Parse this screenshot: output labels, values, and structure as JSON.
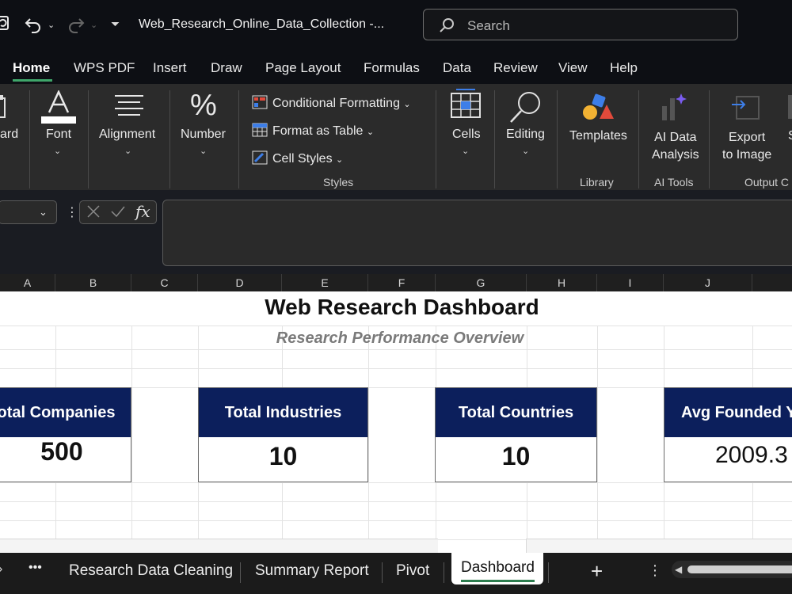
{
  "titlebar": {
    "document_title": "Web_Research_Online_Data_Collection  -...",
    "search_placeholder": "Search"
  },
  "ribbon_tabs": [
    "Home",
    "WPS PDF",
    "Insert",
    "Draw",
    "Page Layout",
    "Formulas",
    "Data",
    "Review",
    "View",
    "Help"
  ],
  "ribbon": {
    "clipboard_label": "ard",
    "font_label": "Font",
    "alignment_label": "Alignment",
    "number_label": "Number",
    "conditional_formatting": "Conditional Formatting",
    "format_as_table": "Format as Table",
    "cell_styles": "Cell Styles",
    "styles_group": "Styles",
    "cells_label": "Cells",
    "editing_label": "Editing",
    "templates_label": "Templates",
    "library_group": "Library",
    "ai_data_line1": "AI Data",
    "ai_data_line2": "Analysis",
    "ai_tools_group": "AI Tools",
    "export_line1": "Export",
    "export_line2": "to Image",
    "output_group": "Output C",
    "overflow_label": "S"
  },
  "columns": [
    "A",
    "B",
    "C",
    "D",
    "E",
    "F",
    "G",
    "H",
    "I",
    "J"
  ],
  "dashboard": {
    "title": "Web Research Dashboard",
    "subtitle": "Research Performance Overview",
    "kpis": [
      {
        "label": "otal Companies",
        "value": "500"
      },
      {
        "label": "Total Industries",
        "value": "10"
      },
      {
        "label": "Total Countries",
        "value": "10"
      },
      {
        "label": "Avg Founded Y",
        "value": "2009.3"
      }
    ]
  },
  "sheet_tabs": {
    "more": "•••",
    "tabs": [
      "Research Data Cleaning",
      "Summary Report",
      "Pivot",
      "Dashboard"
    ],
    "active": "Dashboard",
    "add": "+"
  },
  "colors": {
    "kpi_header": "#0c1f5c",
    "active_tab_underline": "#3fa66a"
  }
}
